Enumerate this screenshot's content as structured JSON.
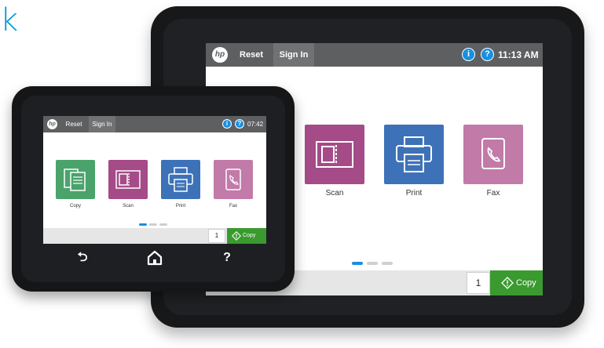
{
  "headline_fragment": "k",
  "large_device": {
    "header": {
      "reset_label": "Reset",
      "signin_label": "Sign In",
      "info_glyph": "i",
      "help_glyph": "?",
      "time": "11:13 AM"
    },
    "apps": [
      {
        "label": "Scan",
        "icon": "scan-icon",
        "color": "#a44b88"
      },
      {
        "label": "Print",
        "icon": "print-icon",
        "color": "#3d72b8"
      },
      {
        "label": "Fax",
        "icon": "fax-icon",
        "color": "#c27aa9"
      }
    ],
    "page_indicator": {
      "pages": 3,
      "current": 1
    },
    "copy_count": "1",
    "copy_button_label": "Copy"
  },
  "small_device": {
    "header": {
      "reset_label": "Reset",
      "signin_label": "Sign In",
      "info_glyph": "i",
      "help_glyph": "?",
      "time": "07:42"
    },
    "apps": [
      {
        "label": "Copy",
        "icon": "copy-icon",
        "color": "#4aa36b"
      },
      {
        "label": "Scan",
        "icon": "scan-icon",
        "color": "#a44b88"
      },
      {
        "label": "Print",
        "icon": "print-icon",
        "color": "#3d72b8"
      },
      {
        "label": "Fax",
        "icon": "fax-icon",
        "color": "#c27aa9"
      }
    ],
    "page_indicator": {
      "pages": 3,
      "current": 1
    },
    "copy_count": "1",
    "copy_button_label": "Copy",
    "nav": {
      "back_glyph": "⮌",
      "home_glyph": "⌂",
      "help_glyph": "?"
    }
  },
  "colors": {
    "accent_blue": "#0096d6",
    "topbar": "#5e5f61",
    "copy_green": "#3a9a2f",
    "indicator_active": "#1a8fe0",
    "indicator_inactive": "#cfcfcf"
  }
}
